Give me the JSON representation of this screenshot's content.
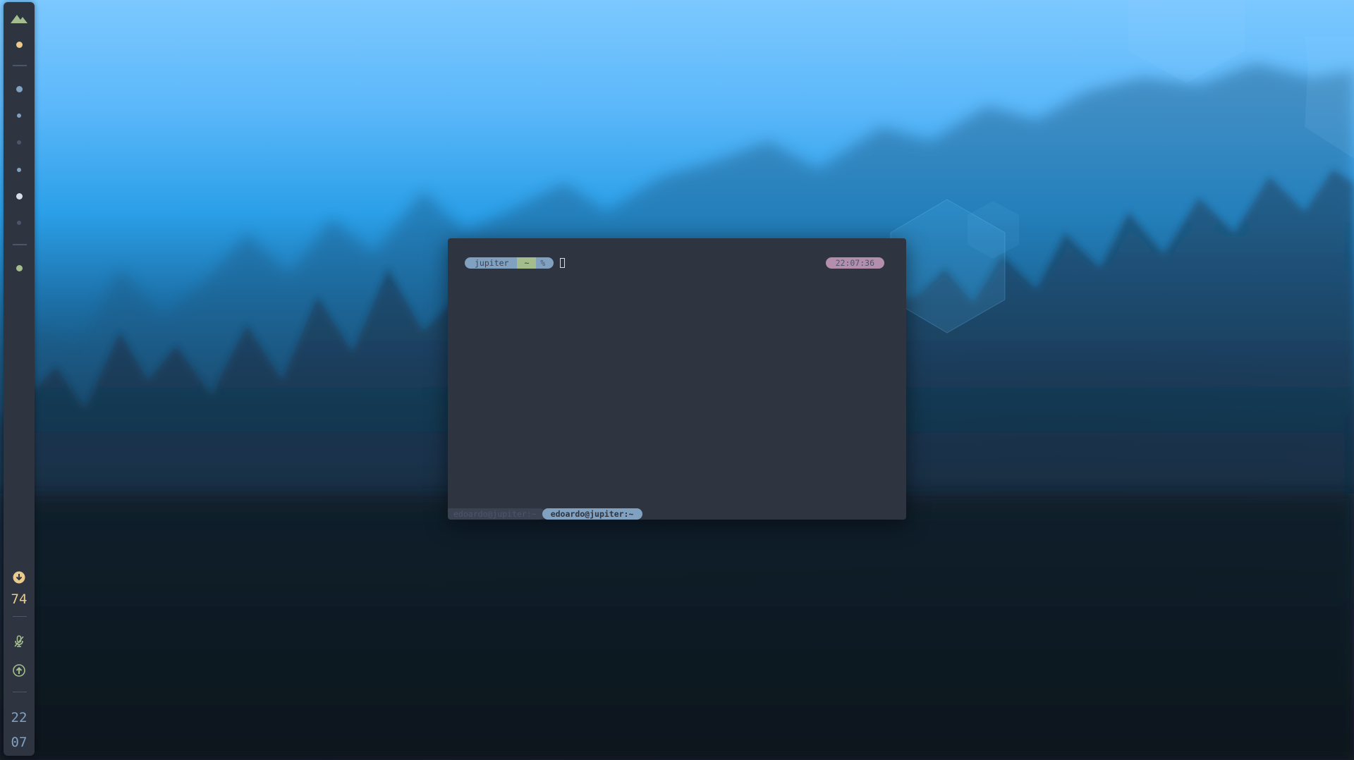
{
  "sidebar": {
    "workspace_dots": [
      {
        "color": "#ebcb8b"
      },
      {
        "color": "#81a1c1"
      },
      {
        "color": "#81a1c1"
      },
      {
        "color": "#4c566a"
      },
      {
        "color": "#81a1c1"
      },
      {
        "color": "#d8dee9"
      },
      {
        "color": "#4c566a"
      },
      {
        "color": "#a3be8c"
      }
    ],
    "logo_icon": "mountain-icon",
    "volume_icon": "download-circle-icon",
    "volume_value": "74",
    "mic_icon": "microphone-off-icon",
    "upload_icon": "upload-circle-icon",
    "clock_hour": "22",
    "clock_minute": "07"
  },
  "terminal": {
    "prompt_host": "jupiter",
    "prompt_dir": "~",
    "prompt_symbol": "%",
    "right_clock": "22:07:36",
    "tabs": [
      {
        "label": "edoardo@jupiter:~",
        "active": false
      },
      {
        "label": "edoardo@jupiter:~",
        "active": true
      }
    ]
  },
  "colors": {
    "panel_bg": "#2e3440",
    "accent_blue": "#81a1c1",
    "accent_green": "#a3be8c",
    "accent_purple": "#b48ead",
    "accent_yellow": "#ebcb8b"
  }
}
